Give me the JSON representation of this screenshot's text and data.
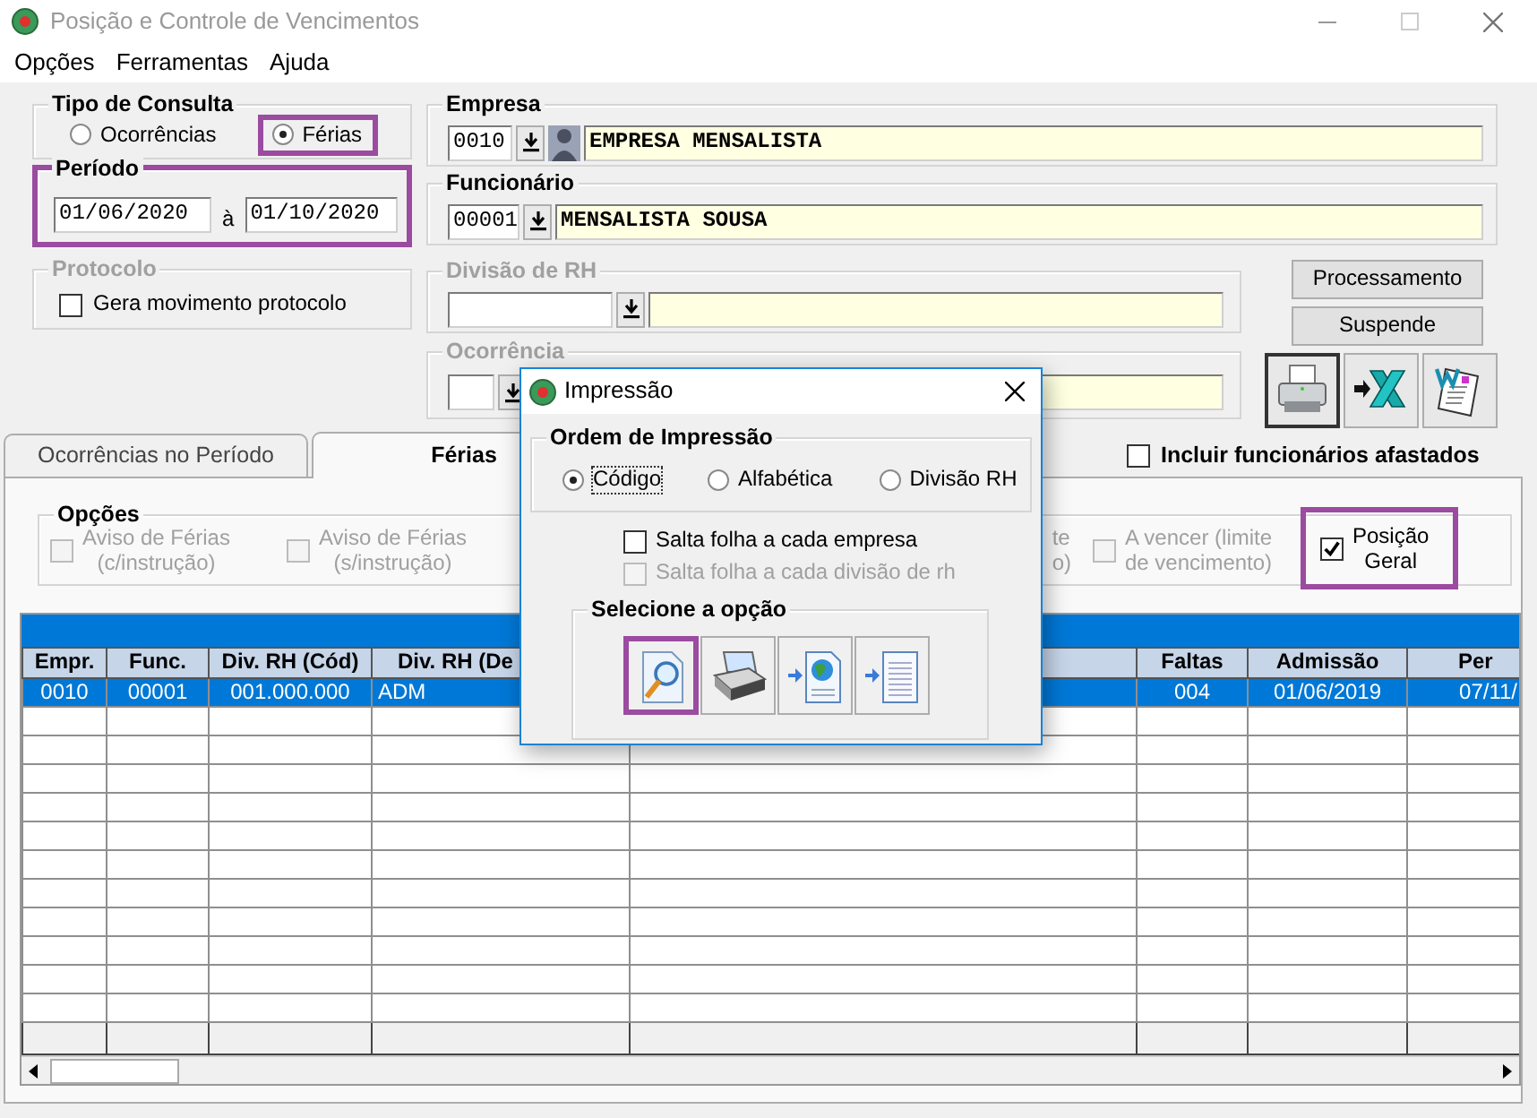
{
  "window": {
    "title": "Posição e Controle de Vencimentos"
  },
  "menu": [
    "Opções",
    "Ferramentas",
    "Ajuda"
  ],
  "tipo_consulta": {
    "title": "Tipo de Consulta",
    "options": [
      {
        "label": "Ocorrências",
        "selected": false,
        "highlighted": false
      },
      {
        "label": "Férias",
        "selected": true,
        "highlighted": true
      }
    ]
  },
  "periodo": {
    "title": "Período",
    "from": "01/06/2020",
    "separator": "à",
    "to": "01/10/2020",
    "highlighted": true
  },
  "protocolo": {
    "title": "Protocolo",
    "disabled": true,
    "checkbox": {
      "label": "Gera movimento protocolo",
      "checked": false
    }
  },
  "empresa": {
    "title": "Empresa",
    "code": "0010",
    "name": "EMPRESA MENSALISTA"
  },
  "funcionario": {
    "title": "Funcionário",
    "code": "00001",
    "name": "MENSALISTA SOUSA"
  },
  "divisao": {
    "title": "Divisão de RH",
    "disabled": true
  },
  "ocorrencia": {
    "title": "Ocorrência",
    "disabled": true
  },
  "buttons": [
    "Processamento",
    "Suspende"
  ],
  "export_buttons": [
    {
      "kind": "print",
      "focused": true
    },
    {
      "kind": "spreadsheet",
      "focused": false
    },
    {
      "kind": "document",
      "focused": false
    }
  ],
  "tabs": [
    {
      "label": "Ocorrências no Período",
      "selected": false
    },
    {
      "label": "Férias",
      "selected": true
    }
  ],
  "incluir_afastados": {
    "label": "Incluir funcionários afastados",
    "checked": false
  },
  "opcoes": {
    "title": "Opções",
    "items": [
      {
        "kind": "checkbox",
        "lines": [
          "Aviso de Férias",
          "(c/instrução)"
        ],
        "checked": false,
        "disabled": true,
        "highlighted": false
      },
      {
        "kind": "checkbox",
        "lines": [
          "Aviso de Férias",
          "(s/instrução)"
        ],
        "checked": false,
        "disabled": true,
        "highlighted": false
      },
      {
        "kind": "partial",
        "lines": [
          "te",
          "o)"
        ],
        "disabled": true
      },
      {
        "kind": "checkbox",
        "lines": [
          "A vencer (limite",
          "de vencimento)"
        ],
        "checked": false,
        "disabled": true,
        "highlighted": false
      },
      {
        "kind": "checkbox",
        "lines": [
          "Posição",
          "Geral"
        ],
        "checked": true,
        "disabled": false,
        "highlighted": true
      }
    ]
  },
  "grid": {
    "columns": [
      {
        "kind": "center",
        "label": "Empr."
      },
      {
        "kind": "center",
        "label": "Func."
      },
      {
        "kind": "center",
        "label": "Div. RH (Cód)"
      },
      {
        "kind": "left",
        "label": "Div. RH (De"
      },
      {
        "kind": "blank"
      },
      {
        "kind": "center",
        "label": "Faltas"
      },
      {
        "kind": "center",
        "label": "Admissão"
      },
      {
        "kind": "right",
        "label": "Per"
      }
    ],
    "rows": [
      {
        "selected": true,
        "cells": [
          "0010",
          "00001",
          "001.000.000",
          "ADM",
          "",
          "004",
          "01/06/2019",
          "07/11/"
        ]
      }
    ]
  },
  "dialog": {
    "title": "Impressão",
    "ordem": {
      "title": "Ordem de Impressão",
      "options": [
        {
          "label": "Código",
          "selected": true
        },
        {
          "label": "Alfabética",
          "selected": false
        },
        {
          "label": "Divisão RH",
          "selected": false
        }
      ]
    },
    "checkboxes": [
      {
        "label": "Salta folha a cada empresa",
        "checked": false,
        "disabled": false
      },
      {
        "label": "Salta folha a cada divisão de rh",
        "checked": false,
        "disabled": true
      }
    ],
    "selecione": {
      "title": "Selecione a opção",
      "buttons": [
        {
          "kind": "preview",
          "highlighted": true
        },
        {
          "kind": "print",
          "highlighted": false
        },
        {
          "kind": "web",
          "highlighted": false
        },
        {
          "kind": "file",
          "highlighted": false
        }
      ]
    }
  }
}
